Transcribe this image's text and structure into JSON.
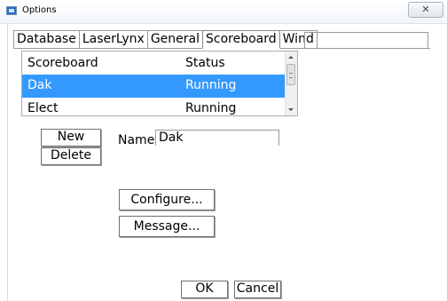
{
  "window": {
    "title": "Options",
    "close_glyph": "✕"
  },
  "tabs": [
    {
      "label": "Database"
    },
    {
      "label": "LaserLynx"
    },
    {
      "label": "General"
    },
    {
      "label": "Scoreboard",
      "active": true
    },
    {
      "label": "Wind"
    }
  ],
  "scoreboard_list": {
    "headers": [
      "Scoreboard",
      "Status"
    ],
    "rows": [
      {
        "name": "Dak",
        "status": "Running",
        "selected": true
      },
      {
        "name": "Elect",
        "status": "Running"
      }
    ],
    "selected_color": "#3399ff"
  },
  "buttons": {
    "new": "New",
    "delete": "Delete",
    "configure": "Configure...",
    "message": "Message...",
    "ok": "OK",
    "cancel": "Cancel"
  },
  "name_field": {
    "label": "Name:",
    "value": "Dak"
  },
  "icons": {
    "app": "options-window-icon",
    "close": "close-icon"
  }
}
